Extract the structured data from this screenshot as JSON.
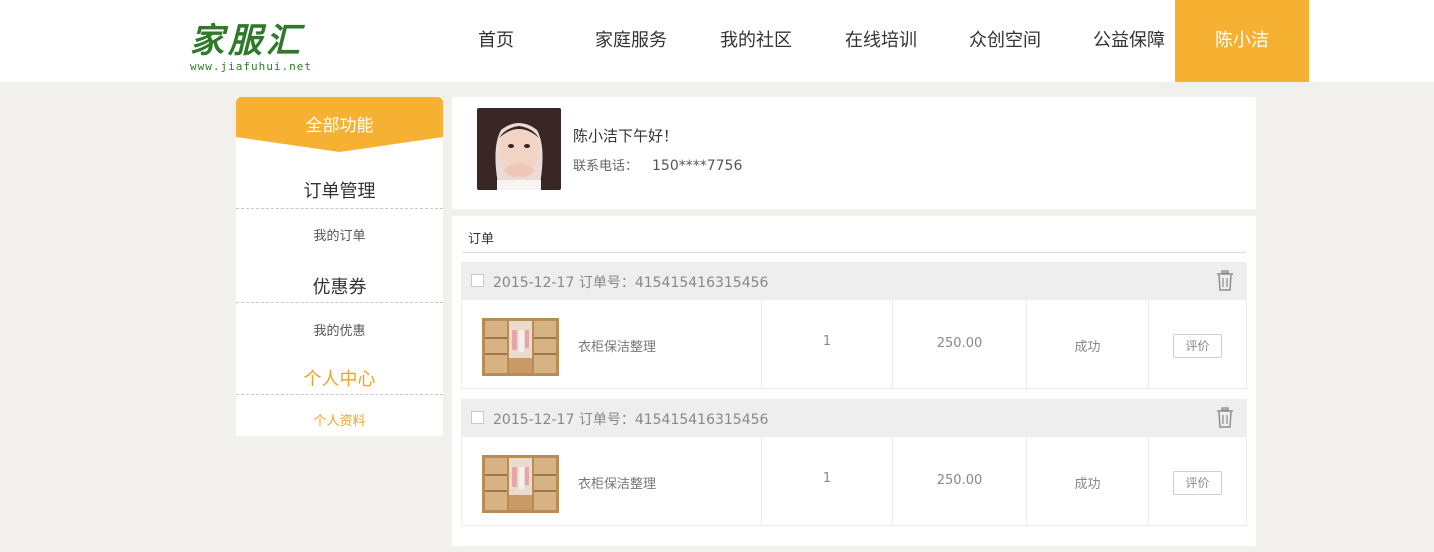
{
  "brand": {
    "logo_text": "家服汇",
    "logo_url": "www.jiafuhui.net",
    "accent_color": "#f6b132",
    "logo_color": "#2f7a2a"
  },
  "nav": {
    "items": [
      "首页",
      "家庭服务",
      "我的社区",
      "在线培训",
      "众创空间",
      "公益保障"
    ],
    "user_name": "陈小洁"
  },
  "sidebar": {
    "header": "全部功能",
    "sections": [
      {
        "title": "订单管理",
        "link": "我的订单"
      },
      {
        "title": "优惠券",
        "link": "我的优惠"
      },
      {
        "title": "个人中心",
        "link": "个人资料"
      }
    ]
  },
  "profile": {
    "greeting": "陈小洁下午好！",
    "phone_label": "联系电话：",
    "phone": "150****7756"
  },
  "orders": {
    "title": "订单",
    "list": [
      {
        "date": "2015-12-17",
        "order_no_label": "订单号：",
        "order_no": "415415416315456",
        "service": "衣柜保洁整理",
        "quantity": "1",
        "price": "250.00",
        "status": "成功",
        "action": "评价"
      },
      {
        "date": "2015-12-17",
        "order_no_label": "订单号：",
        "order_no": "415415416315456",
        "service": "衣柜保洁整理",
        "quantity": "1",
        "price": "250.00",
        "status": "成功",
        "action": "评价"
      }
    ]
  },
  "icons": {
    "delete": "trash-icon",
    "checkbox": "checkbox-icon"
  }
}
